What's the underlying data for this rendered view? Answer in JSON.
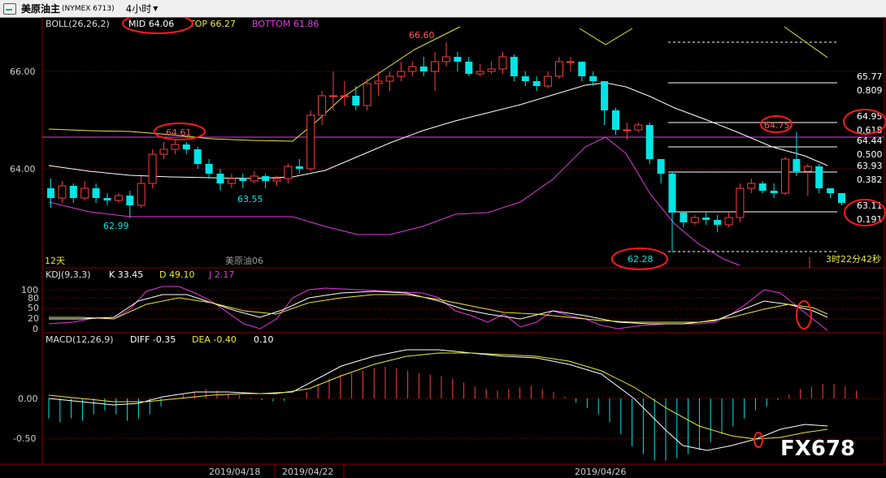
{
  "header": {
    "instrument": "美原油主",
    "code": "(NYMEX 6713)",
    "period": "4小时",
    "period_arrow": "▼"
  },
  "main_panel": {
    "indicator_name": "BOLL(26,26,2)",
    "mid_label": "MID 64.06",
    "top_label": "TOP 66.27",
    "bottom_label": "BOTTOM 61.86",
    "y_ticks": [
      "66.00",
      "64.00"
    ],
    "annotations": {
      "high_66_60": "66.60",
      "high_64_61": "64.61",
      "low_62_99": "62.99",
      "low_63_55": "63.55",
      "low_62_28": "62.28",
      "high_64_75": "64.75"
    },
    "fib_levels": [
      {
        "price": "65.77",
        "ratio": "0.809"
      },
      {
        "price": "64.95",
        "ratio": "0.618"
      },
      {
        "price": "64.44",
        "ratio": "0.500"
      },
      {
        "price": "63.93",
        "ratio": "0.382"
      },
      {
        "price": "63.11",
        "ratio": "0.191"
      }
    ],
    "bottom_left_label": "12天",
    "bottom_mid_label": "美原油06",
    "countdown": "3时22分42秒"
  },
  "kdj_panel": {
    "indicator_name": "KDJ(9,3,3)",
    "k_label": "K 33.45",
    "d_label": "D 49.10",
    "j_label": "J 2.17",
    "y_ticks": [
      "100",
      "80",
      "50",
      "20",
      "0"
    ]
  },
  "macd_panel": {
    "indicator_name": "MACD(12,26,9)",
    "diff_label": "DIFF -0.35",
    "dea_label": "DEA -0.40",
    "macd_label": "0.10",
    "y_ticks": [
      "0.00",
      "-0.50"
    ]
  },
  "x_axis": {
    "dates": [
      "2019/04/18",
      "2019/04/22",
      "2019/04/26"
    ]
  },
  "watermark": "FX678",
  "colors": {
    "up": "#ff3b3b",
    "down": "#00e5e5",
    "mid_line": "#ffffff",
    "top_line": "#e8e83a",
    "bottom_line": "#e03be0",
    "highlight_circle": "#ff1a1a"
  },
  "chart_data": {
    "type": "candlestick",
    "candles": [
      [
        63.6,
        63.4,
        63.8,
        63.2
      ],
      [
        63.4,
        63.65,
        63.75,
        63.3
      ],
      [
        63.65,
        63.4,
        63.7,
        63.3
      ],
      [
        63.4,
        63.6,
        63.75,
        63.35
      ],
      [
        63.6,
        63.4,
        63.7,
        63.3
      ],
      [
        63.4,
        63.35,
        63.5,
        63.25
      ],
      [
        63.35,
        63.45,
        63.5,
        63.3
      ],
      [
        63.45,
        63.25,
        63.55,
        62.99
      ],
      [
        63.25,
        63.7,
        63.85,
        63.2
      ],
      [
        63.7,
        64.3,
        64.4,
        63.6
      ],
      [
        64.3,
        64.4,
        64.55,
        64.2
      ],
      [
        64.4,
        64.5,
        64.61,
        64.3
      ],
      [
        64.5,
        64.4,
        64.55,
        64.3
      ],
      [
        64.4,
        64.1,
        64.45,
        64.0
      ],
      [
        64.1,
        63.9,
        64.2,
        63.8
      ],
      [
        63.9,
        63.7,
        64.0,
        63.55
      ],
      [
        63.7,
        63.8,
        63.9,
        63.6
      ],
      [
        63.8,
        63.75,
        63.9,
        63.6
      ],
      [
        63.75,
        63.85,
        63.95,
        63.7
      ],
      [
        63.85,
        63.75,
        63.9,
        63.6
      ],
      [
        63.75,
        63.8,
        63.85,
        63.65
      ],
      [
        63.8,
        64.05,
        64.1,
        63.7
      ],
      [
        64.05,
        64.0,
        64.2,
        63.9
      ],
      [
        64.0,
        65.1,
        65.2,
        63.95
      ],
      [
        65.1,
        65.5,
        65.6,
        64.9
      ],
      [
        65.5,
        65.5,
        66.0,
        65.2
      ],
      [
        65.5,
        65.5,
        65.8,
        65.3
      ],
      [
        65.5,
        65.3,
        65.7,
        65.2
      ],
      [
        65.3,
        65.75,
        65.85,
        65.2
      ],
      [
        65.75,
        65.8,
        66.0,
        65.5
      ],
      [
        65.8,
        65.9,
        66.0,
        65.6
      ],
      [
        65.9,
        66.0,
        66.2,
        65.8
      ],
      [
        66.0,
        66.1,
        66.2,
        65.9
      ],
      [
        66.1,
        66.0,
        66.3,
        65.9
      ],
      [
        66.0,
        66.2,
        66.4,
        65.6
      ],
      [
        66.2,
        66.3,
        66.6,
        66.1
      ],
      [
        66.3,
        66.2,
        66.4,
        66.0
      ],
      [
        66.2,
        65.95,
        66.3,
        65.9
      ],
      [
        65.95,
        66.0,
        66.15,
        65.9
      ],
      [
        66.0,
        66.05,
        66.2,
        65.95
      ],
      [
        66.05,
        66.3,
        66.4,
        65.95
      ],
      [
        66.3,
        65.9,
        66.35,
        65.8
      ],
      [
        65.9,
        65.8,
        66.0,
        65.7
      ],
      [
        65.8,
        65.7,
        65.9,
        65.6
      ],
      [
        65.7,
        65.9,
        66.0,
        65.65
      ],
      [
        65.9,
        66.2,
        66.3,
        65.85
      ],
      [
        66.2,
        66.2,
        66.3,
        66.0
      ],
      [
        66.2,
        65.9,
        66.2,
        65.8
      ],
      [
        65.9,
        65.8,
        66.0,
        65.7
      ],
      [
        65.8,
        65.2,
        65.8,
        64.9
      ],
      [
        65.2,
        64.8,
        65.25,
        64.7
      ],
      [
        64.8,
        64.8,
        64.95,
        64.6
      ],
      [
        64.8,
        64.9,
        64.95,
        64.75
      ],
      [
        64.9,
        64.2,
        64.95,
        64.1
      ],
      [
        64.2,
        63.9,
        64.2,
        63.7
      ],
      [
        63.9,
        63.1,
        63.95,
        62.28
      ],
      [
        63.1,
        62.9,
        63.1,
        62.8
      ],
      [
        62.9,
        63.0,
        63.05,
        62.85
      ],
      [
        63.0,
        62.95,
        63.1,
        62.85
      ],
      [
        62.95,
        62.85,
        63.05,
        62.7
      ],
      [
        62.85,
        63.0,
        63.1,
        62.8
      ],
      [
        63.0,
        63.6,
        63.7,
        62.9
      ],
      [
        63.6,
        63.7,
        63.8,
        63.5
      ],
      [
        63.7,
        63.55,
        63.75,
        63.5
      ],
      [
        63.55,
        63.5,
        63.7,
        63.4
      ],
      [
        63.5,
        64.2,
        64.25,
        63.45
      ],
      [
        64.2,
        63.95,
        64.75,
        63.85
      ],
      [
        63.95,
        64.05,
        64.1,
        63.45
      ],
      [
        64.05,
        63.6,
        64.1,
        63.5
      ],
      [
        63.6,
        63.5,
        63.6,
        63.4
      ],
      [
        63.5,
        63.3,
        63.5,
        63.25
      ]
    ]
  }
}
